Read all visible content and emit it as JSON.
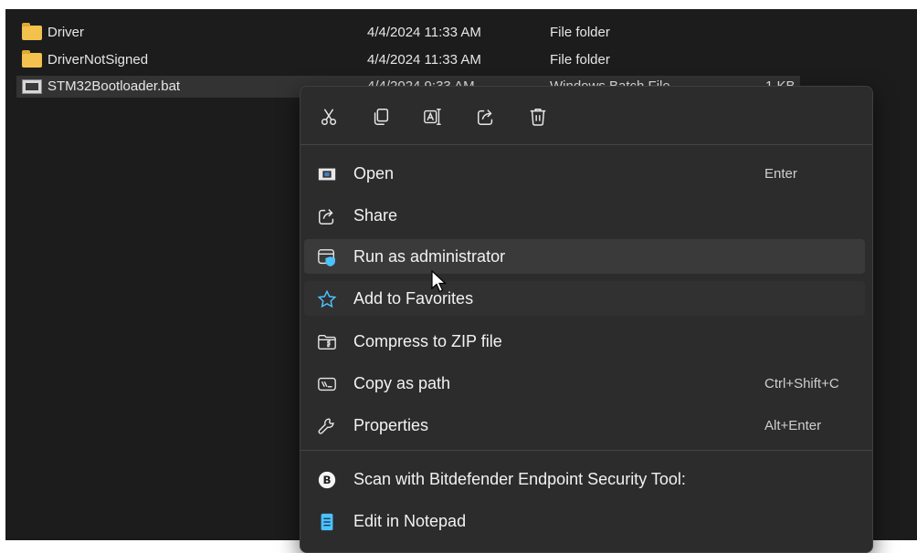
{
  "files": [
    {
      "name": "Driver",
      "date": "4/4/2024 11:33 AM",
      "type": "File folder",
      "size": "",
      "icon": "folder-icon"
    },
    {
      "name": "DriverNotSigned",
      "date": "4/4/2024 11:33 AM",
      "type": "File folder",
      "size": "",
      "icon": "folder-icon"
    },
    {
      "name": "STM32Bootloader.bat",
      "date": "4/4/2024 9:33 AM",
      "type": "Windows Batch File",
      "size": "1 KB",
      "icon": "batch-file-icon"
    }
  ],
  "context_menu": {
    "quick_actions": [
      {
        "name": "cut",
        "icon": "scissors-icon"
      },
      {
        "name": "copy",
        "icon": "copy-icon"
      },
      {
        "name": "rename",
        "icon": "rename-icon"
      },
      {
        "name": "share",
        "icon": "share-icon"
      },
      {
        "name": "delete",
        "icon": "trash-icon"
      }
    ],
    "items": [
      {
        "label": "Open",
        "shortcut": "Enter",
        "icon": "open-icon"
      },
      {
        "label": "Share",
        "shortcut": "",
        "icon": "share-icon"
      },
      {
        "label": "Run as administrator",
        "shortcut": "",
        "icon": "shield-window-icon"
      },
      {
        "label": "Add to Favorites",
        "shortcut": "",
        "icon": "star-icon"
      },
      {
        "label": "Compress to ZIP file",
        "shortcut": "",
        "icon": "zip-folder-icon"
      },
      {
        "label": "Copy as path",
        "shortcut": "Ctrl+Shift+C",
        "icon": "path-icon"
      },
      {
        "label": "Properties",
        "shortcut": "Alt+Enter",
        "icon": "wrench-icon"
      },
      {
        "label": "Scan with Bitdefender Endpoint Security Tool:",
        "shortcut": "",
        "icon": "bitdefender-icon"
      },
      {
        "label": "Edit in Notepad",
        "shortcut": "",
        "icon": "notepad-icon"
      }
    ]
  },
  "colors": {
    "accent": "#4cc2ff",
    "menu_bg": "#2c2c2c",
    "window_bg": "#1c1c1c"
  }
}
